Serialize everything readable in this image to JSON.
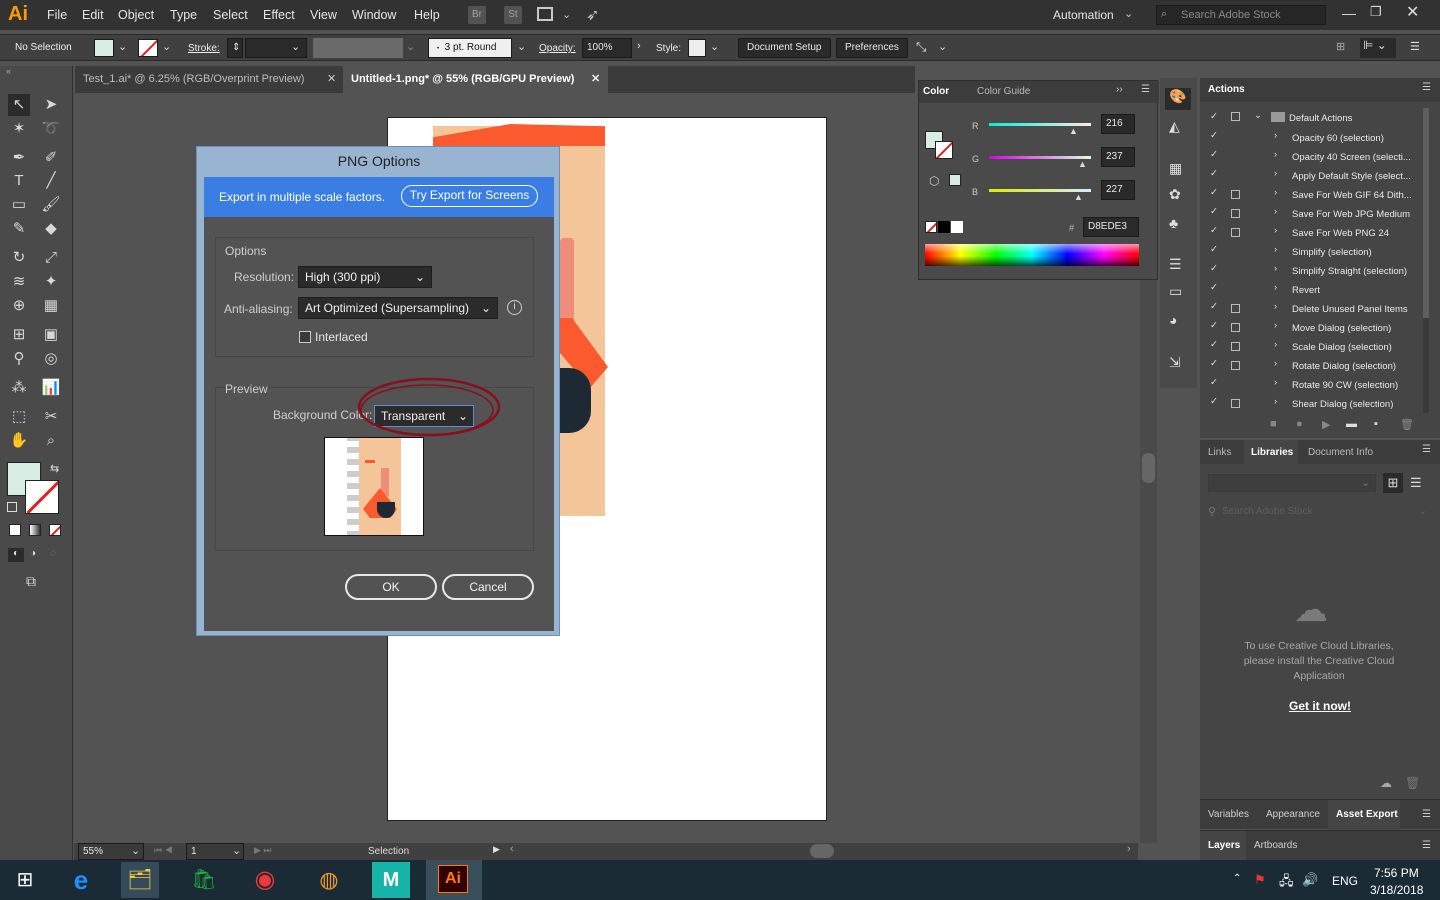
{
  "app": {
    "logo": "Ai",
    "menu": [
      "File",
      "Edit",
      "Object",
      "Type",
      "Select",
      "Effect",
      "View",
      "Window",
      "Help"
    ],
    "bridge": "Br",
    "stock": "St",
    "workspace": "Automation",
    "search_placeholder": "Search Adobe Stock"
  },
  "control_bar": {
    "selection": "No Selection",
    "stroke_label": "Stroke:",
    "brush": "3 pt. Round",
    "opacity_label": "Opacity:",
    "opacity_value": "100%",
    "style_label": "Style:",
    "document_setup": "Document Setup",
    "preferences": "Preferences"
  },
  "tabs": [
    {
      "label": "Test_1.ai* @ 6.25% (RGB/Overprint Preview)"
    },
    {
      "label": "Untitled-1.png* @ 55% (RGB/GPU Preview)"
    }
  ],
  "dialog": {
    "title": "PNG Options",
    "banner_text": "Export in multiple scale factors.",
    "banner_button": "Try Export for Screens",
    "options_label": "Options",
    "resolution_label": "Resolution:",
    "resolution_value": "High (300 ppi)",
    "antialias_label": "Anti-aliasing:",
    "antialias_value": "Art Optimized (Supersampling)",
    "interlaced_label": "Interlaced",
    "preview_label": "Preview",
    "bg_label": "Background Color:",
    "bg_value": "Transparent",
    "ok": "OK",
    "cancel": "Cancel"
  },
  "color_panel": {
    "tab_color": "Color",
    "tab_guide": "Color Guide",
    "r_label": "R",
    "r_value": "216",
    "g_label": "G",
    "g_value": "237",
    "b_label": "B",
    "b_value": "227",
    "hex_label": "#",
    "hex_value": "D8EDE3",
    "swatch_color": "#D8EDE3"
  },
  "actions_panel": {
    "title": "Actions",
    "set": "Default Actions",
    "items": [
      "Opacity 60 (selection)",
      "Opacity 40 Screen (selecti...",
      "Apply Default Style (select...",
      "Save For Web GIF 64 Dith...",
      "Save For Web JPG Medium",
      "Save For Web PNG 24",
      "Simplify (selection)",
      "Simplify Straight (selection)",
      "Revert",
      "Delete Unused Panel Items",
      "Move Dialog (selection)",
      "Scale Dialog (selection)",
      "Rotate Dialog (selection)",
      "Rotate 90 CW (selection)",
      "Shear Dialog (selection)"
    ]
  },
  "libraries_panel": {
    "tabs": [
      "Links",
      "Libraries",
      "Document Info"
    ],
    "search_placeholder": "Search Adobe Stock",
    "message": "To use Creative Cloud Libraries, please install the Creative Cloud Application",
    "link": "Get it now!"
  },
  "bottom_panels": {
    "row1": [
      "Variables",
      "Appearance",
      "Asset Export"
    ],
    "row2": [
      "Layers",
      "Artboards"
    ]
  },
  "status": {
    "zoom": "55%",
    "artboard": "1",
    "tool": "Selection"
  },
  "taskbar": {
    "lang": "ENG",
    "time": "7:56 PM",
    "date": "3/18/2018",
    "ai_icon": "Ai",
    "maya_icon": "M"
  }
}
